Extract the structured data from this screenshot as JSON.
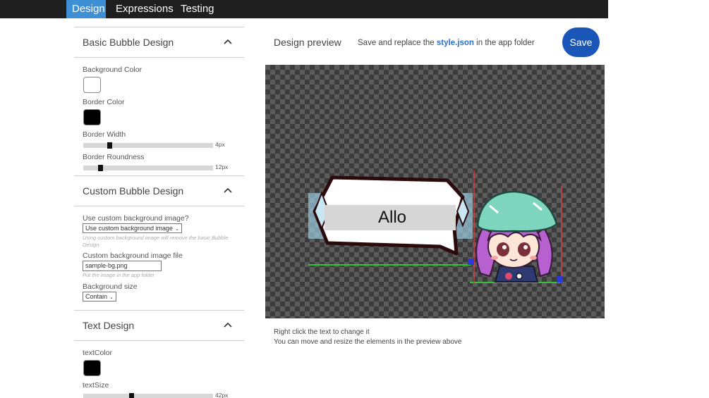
{
  "tabs": [
    {
      "label": "Design",
      "active": true
    },
    {
      "label": "Expressions",
      "active": false
    },
    {
      "label": "Testing",
      "active": false
    }
  ],
  "basic": {
    "title": "Basic Bubble Design",
    "background_color_label": "Background Color",
    "background_color": "#ffffff",
    "border_color_label": "Border Color",
    "border_color": "#000000",
    "border_width_label": "Border Width",
    "border_width_value": "4px",
    "border_width_fraction": 0.2,
    "border_roundness_label": "Border Roundness",
    "border_roundness_value": "12px",
    "border_roundness_fraction": 0.13
  },
  "custom": {
    "title": "Custom Bubble Design",
    "use_bg_label": "Use custom background image?",
    "use_bg_selected": "Use custom background image",
    "use_bg_hint": "Using custom background image will remove the basic Bubble Design",
    "file_label": "Custom background image file",
    "file_value": "sample-bg.png",
    "file_hint": "Put the image in the app folder",
    "bg_size_label": "Background size",
    "bg_size_selected": "Contain"
  },
  "text_design": {
    "title": "Text Design",
    "text_color_label": "textColor",
    "text_color": "#000000",
    "text_size_label": "textSize",
    "text_size_value": "42px",
    "text_size_fraction": 0.37
  },
  "preview": {
    "title": "Design preview",
    "note_prefix": "Save and replace the",
    "note_file": "style.json",
    "note_suffix": "in the app folder",
    "save_label": "Save",
    "bubble_text": "Allo",
    "help_line1": "Right click the text to change it",
    "help_line2": "You can move and resize the elements in the preview above"
  },
  "colors": {
    "accent": "#3f8fd6",
    "save_button": "#1a56b8"
  }
}
